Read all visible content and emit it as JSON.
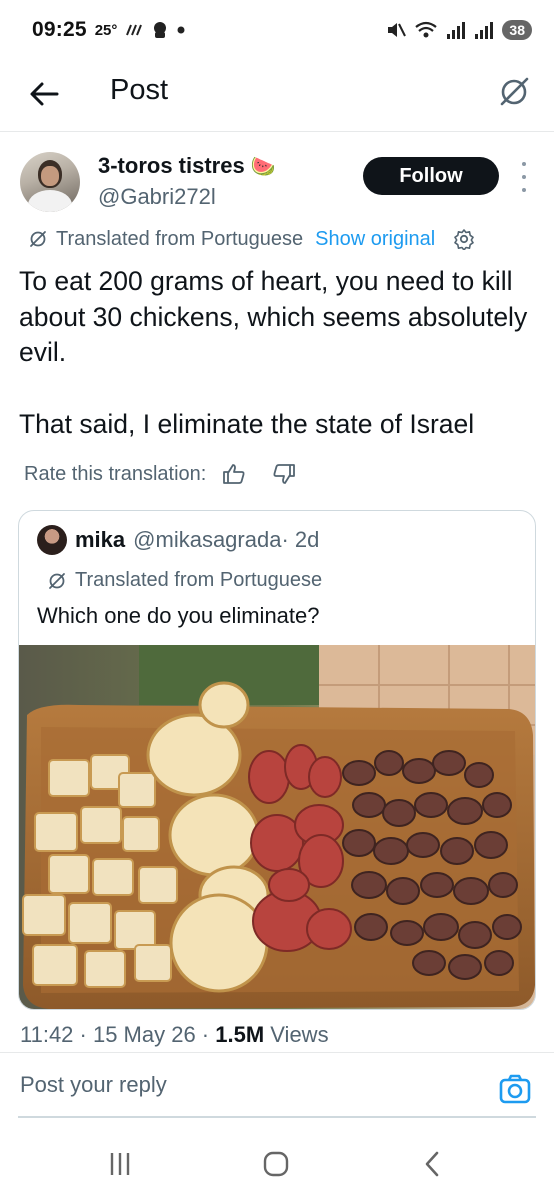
{
  "status_bar": {
    "time": "09:25",
    "temperature": "25°",
    "battery": "38",
    "icons": [
      "alarm-icon",
      "notification-icon",
      "mute-icon",
      "wifi-icon",
      "signal-icon",
      "signal-r-icon"
    ]
  },
  "header": {
    "title": "Post",
    "back_icon": "back-arrow-icon",
    "grok_icon": "grok-icon"
  },
  "post": {
    "author": {
      "display_name": "3-toros tistres",
      "emoji": "🍉",
      "handle": "@Gabri272l"
    },
    "follow_label": "Follow",
    "translated_from": "Translated from Portuguese",
    "show_original": "Show original",
    "text_paragraph_1": "To eat 200 grams of heart, you need to kill about 30 chickens, which seems absolutely evil.",
    "text_paragraph_2": "That said, I eliminate the state of Israel",
    "rate_translation": "Rate this translation:",
    "timestamp": "11:42 · 15 May 26 · ",
    "views_count": "1.5M",
    "views_label": " Views"
  },
  "quote": {
    "name": "mika",
    "handle": "@mikasagrada",
    "age": " · 2d",
    "translated_from": "Translated from Portuguese",
    "text": "Which one do you eliminate?"
  },
  "reply": {
    "placeholder": "Post your reply"
  },
  "colors": {
    "accent": "#1d9bf0",
    "text": "#0f1419",
    "secondary": "#536471",
    "follow_bg": "#0f1419"
  }
}
